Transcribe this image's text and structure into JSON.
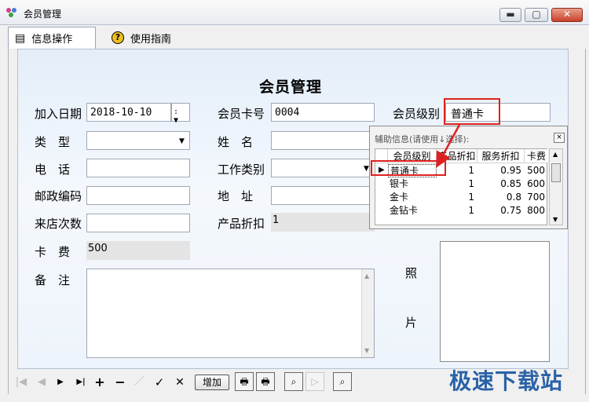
{
  "window": {
    "title": "会员管理"
  },
  "tabs": [
    {
      "label": "信息操作",
      "icon": "list-icon"
    },
    {
      "label": "使用指南",
      "icon": "help-icon"
    }
  ],
  "form": {
    "title": "会员管理",
    "join_date": {
      "label": "加入日期",
      "value": "2018-10-10"
    },
    "type": {
      "label": "类　型",
      "value": ""
    },
    "phone": {
      "label": "电　话",
      "value": ""
    },
    "postcode": {
      "label": "邮政编码",
      "value": ""
    },
    "visits": {
      "label": "来店次数",
      "value": ""
    },
    "card_fee": {
      "label": "卡　费",
      "value": "500"
    },
    "remarks": {
      "label": "备　注",
      "value": ""
    },
    "card_no": {
      "label": "会员卡号",
      "value": "0004"
    },
    "name": {
      "label": "姓　名",
      "value": ""
    },
    "work_type": {
      "label": "工作类别",
      "value": ""
    },
    "address": {
      "label": "地　址",
      "value": ""
    },
    "product_discount": {
      "label": "产品折扣",
      "value": "1"
    },
    "member_level": {
      "label": "会员级别",
      "value": "普通卡"
    },
    "photo": {
      "label_top": "照",
      "label_bottom": "片"
    }
  },
  "popup": {
    "title": "辅助信息(请使用↓选择):",
    "columns": [
      "会员级别",
      "产品折扣",
      "服务折扣",
      "卡费"
    ],
    "rows": [
      [
        "普通卡",
        "1",
        "0.95",
        "500"
      ],
      [
        "银卡",
        "1",
        "0.85",
        "600"
      ],
      [
        "金卡",
        "1",
        "0.8",
        "700"
      ],
      [
        "金钻卡",
        "1",
        "0.75",
        "800"
      ]
    ],
    "close": "×"
  },
  "toolbar": {
    "first": "|◀",
    "prev": "◀",
    "next": "▶",
    "last": "▶|",
    "add": "+",
    "delete": "−",
    "edit": "／",
    "confirm": "✓",
    "cancel": "✕",
    "add_button": "增加"
  },
  "watermark": "极速下载站",
  "colors": {
    "highlight": "#e02020",
    "panel": "#e8f0fa",
    "watermark": "#2a62a8"
  }
}
